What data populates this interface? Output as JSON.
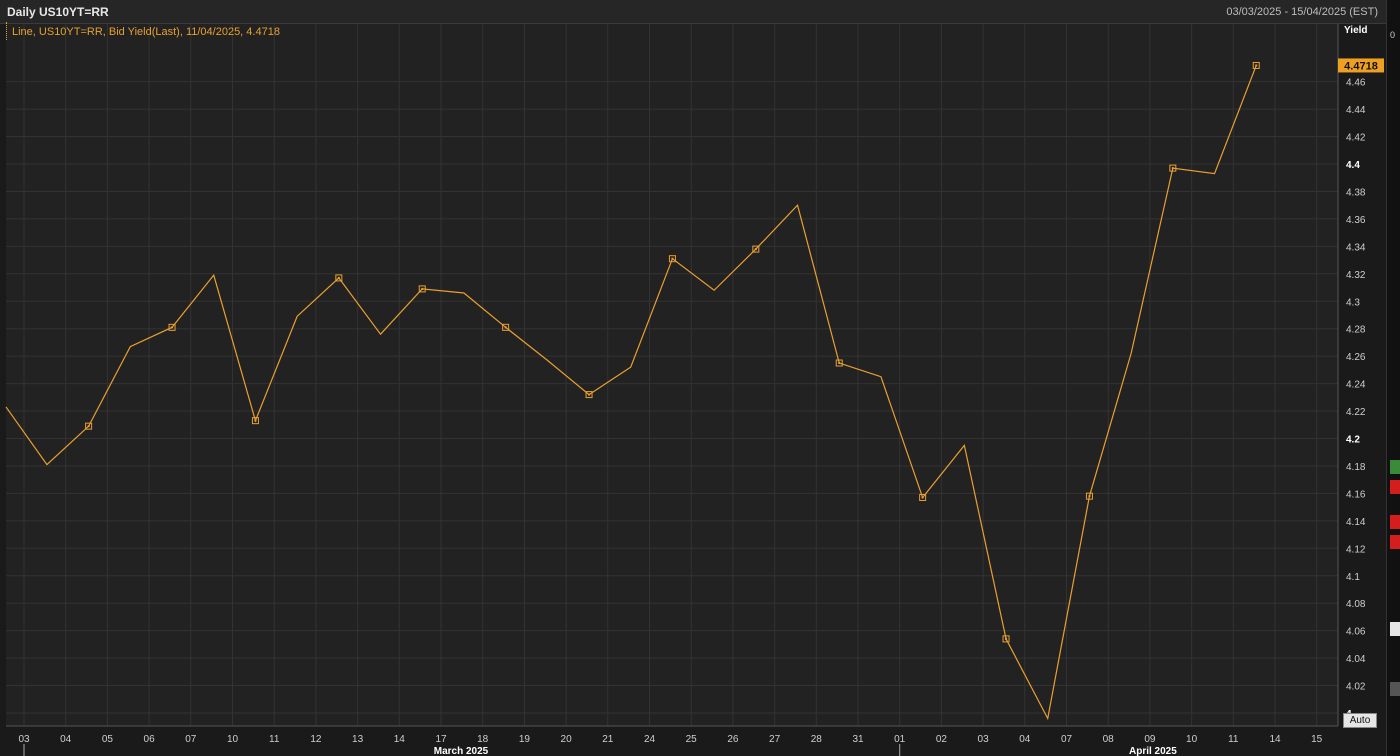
{
  "window": {
    "title": "Daily US10YT=RR",
    "date_range": "03/03/2025 - 15/04/2025 (EST)"
  },
  "legend": {
    "text": "Line, US10YT=RR, Bid Yield(Last), 11/04/2025, 4.4718"
  },
  "last_value_label": "4.4718",
  "auto_button": "Auto",
  "colors": {
    "background": "#1a1a1a",
    "plot_background": "#222222",
    "grid": "#333333",
    "series": "#e8a030",
    "last_value_badge": "#f0a020"
  },
  "chart_data": {
    "type": "line",
    "title": "Daily US10YT=RR",
    "ylabel": "Yield",
    "ylim": [
      4.0,
      4.48
    ],
    "y_ticks": [
      4,
      4.02,
      4.04,
      4.06,
      4.08,
      4.1,
      4.12,
      4.14,
      4.16,
      4.18,
      4.2,
      4.22,
      4.24,
      4.26,
      4.28,
      4.3,
      4.32,
      4.34,
      4.36,
      4.38,
      4.4,
      4.42,
      4.44,
      4.46
    ],
    "y_tick_labels": [
      "4",
      "4.02",
      "4.04",
      "4.06",
      "4.08",
      "4.1",
      "4.12",
      "4.14",
      "4.16",
      "4.18",
      "4.2",
      "4.22",
      "4.24",
      "4.26",
      "4.28",
      "4.3",
      "4.32",
      "4.34",
      "4.36",
      "4.38",
      "4.4",
      "4.42",
      "4.44",
      "4.46"
    ],
    "y_major_ticks": [
      4,
      4.2,
      4.4
    ],
    "x_tick_labels": [
      "03",
      "04",
      "05",
      "06",
      "07",
      "10",
      "11",
      "12",
      "13",
      "14",
      "17",
      "18",
      "19",
      "20",
      "21",
      "24",
      "25",
      "26",
      "27",
      "28",
      "31",
      "01",
      "02",
      "03",
      "04",
      "07",
      "08",
      "09",
      "10",
      "11",
      "14",
      "15"
    ],
    "x_month_labels": [
      {
        "label": "March 2025",
        "at_index": 10
      },
      {
        "label": "April 2025",
        "at_index": 27
      }
    ],
    "grid": true,
    "series": [
      {
        "name": "US10YT=RR, Bid Yield(Last)",
        "values": [
          4.223,
          4.181,
          4.209,
          4.267,
          4.281,
          4.319,
          4.213,
          4.289,
          4.317,
          4.276,
          4.309,
          4.306,
          4.281,
          4.257,
          4.232,
          4.252,
          4.331,
          4.308,
          4.338,
          4.37,
          4.255,
          4.245,
          4.157,
          4.195,
          4.054,
          3.996,
          4.158,
          4.262,
          4.397,
          4.393,
          4.4718
        ]
      }
    ],
    "markers_at": [
      2,
      4,
      6,
      8,
      10,
      12,
      14,
      16,
      18,
      20,
      22,
      24,
      26,
      28,
      30
    ]
  }
}
